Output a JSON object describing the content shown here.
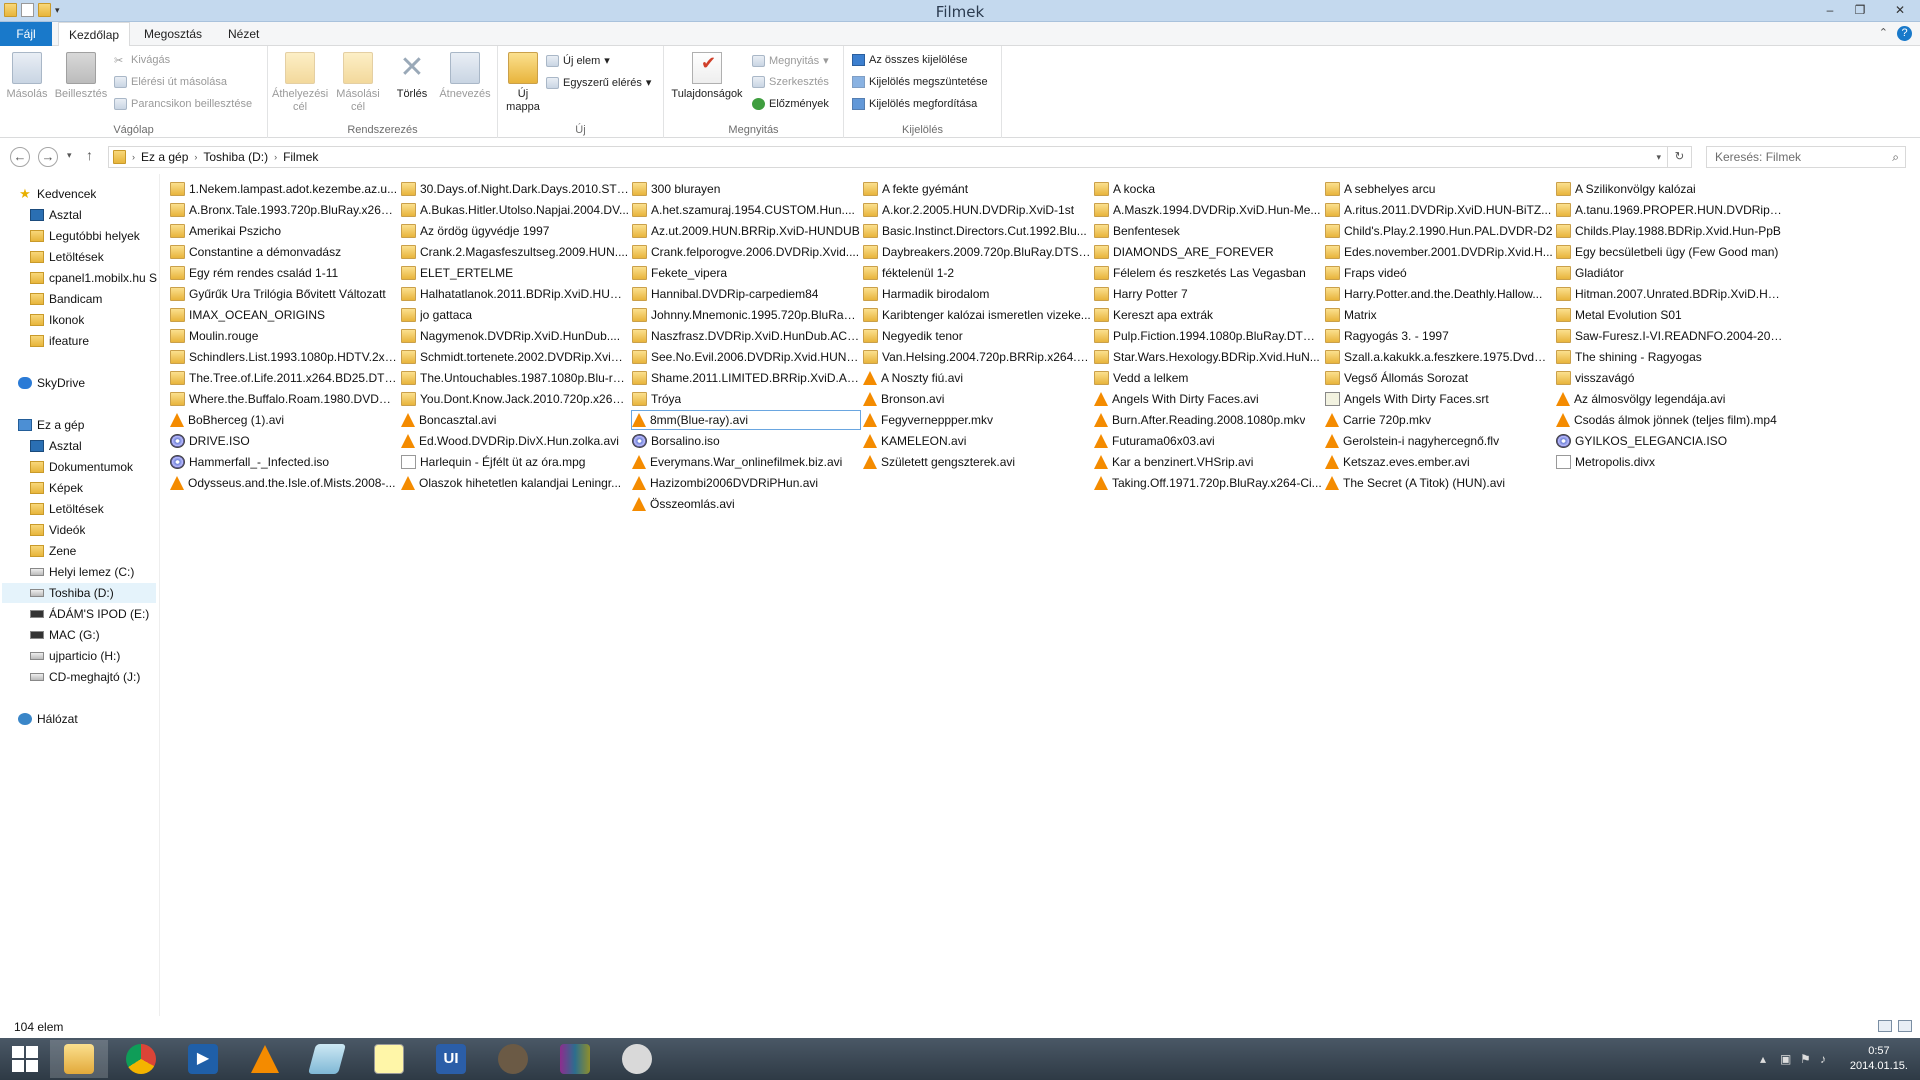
{
  "window": {
    "title": "Filmek",
    "minimize": "–",
    "maximize": "❐",
    "close": "✕"
  },
  "tabs": {
    "file": "Fájl",
    "home": "Kezdőlap",
    "share": "Megosztás",
    "view": "Nézet"
  },
  "ribbon": {
    "clipboard": {
      "label": "Vágólap",
      "copy": "Másolás",
      "paste": "Beillesztés",
      "cut": "Kivágás",
      "copy_path": "Elérési út másolása",
      "paste_shortcut": "Parancsikon beillesztése"
    },
    "organize": {
      "label": "Rendszerezés",
      "move_to": "Áthelyezési cél",
      "copy_to": "Másolási cél",
      "delete": "Törlés",
      "rename": "Átnevezés"
    },
    "new": {
      "label": "Új",
      "new_folder": "Új mappa",
      "new_item": "Új elem",
      "easy_access": "Egyszerű elérés"
    },
    "open": {
      "label": "Megnyitás",
      "properties": "Tulajdonságok",
      "open": "Megnyitás",
      "edit": "Szerkesztés",
      "history": "Előzmények"
    },
    "select": {
      "label": "Kijelölés",
      "select_all": "Az összes kijelölése",
      "select_none": "Kijelölés megszüntetése",
      "invert": "Kijelölés megfordítása"
    }
  },
  "address": {
    "crumbs": [
      "Ez a gép",
      "Toshiba (D:)",
      "Filmek"
    ],
    "search_placeholder": "Keresés: Filmek"
  },
  "nav": {
    "favorites": "Kedvencek",
    "fav_items": [
      "Asztal",
      "Legutóbbi helyek",
      "Letöltések",
      "cpanel1.mobilx.hu S",
      "Bandicam",
      "Ikonok",
      "ifeature"
    ],
    "skydrive": "SkyDrive",
    "this_pc": "Ez a gép",
    "pc_items": [
      "Asztal",
      "Dokumentumok",
      "Képek",
      "Letöltések",
      "Videók",
      "Zene",
      "Helyi lemez (C:)",
      "Toshiba (D:)",
      "ÁDÁM'S IPOD (E:)",
      "MAC (G:)",
      "ujparticio (H:)",
      "CD-meghajtó (J:)"
    ],
    "network": "Hálózat"
  },
  "columns": [
    [
      {
        "n": "1.Nekem.lampast.adot.kezembe.az.u...",
        "t": "folder"
      },
      {
        "n": "A.Bronx.Tale.1993.720p.BluRay.x264....",
        "t": "folder"
      },
      {
        "n": "Amerikai Pszicho",
        "t": "folder"
      },
      {
        "n": "Constantine a démonvadász",
        "t": "folder"
      },
      {
        "n": "Egy rém rendes család 1-11",
        "t": "folder"
      },
      {
        "n": "Gyűrűk Ura Trilógia Bővitett Változatt",
        "t": "folder"
      },
      {
        "n": "IMAX_OCEAN_ORIGINS",
        "t": "folder"
      },
      {
        "n": "Moulin.rouge",
        "t": "folder"
      },
      {
        "n": "Schindlers.List.1993.1080p.HDTV.2xB...",
        "t": "folder"
      },
      {
        "n": "The.Tree.of.Life.2011.x264.BD25.DTS...",
        "t": "folder"
      },
      {
        "n": "Where.the.Buffalo.Roam.1980.DVDRi...",
        "t": "folder"
      },
      {
        "n": "BoBherceg (1).avi",
        "t": "vlc"
      },
      {
        "n": "DRIVE.ISO",
        "t": "iso"
      },
      {
        "n": "Hammerfall_-_Infected.iso",
        "t": "iso"
      },
      {
        "n": "Odysseus.and.the.Isle.of.Mists.2008-...",
        "t": "vlc"
      }
    ],
    [
      {
        "n": "30.Days.of.Night.Dark.Days.2010.STV...",
        "t": "folder"
      },
      {
        "n": "A.Bukas.Hitler.Utolso.Napjai.2004.DV...",
        "t": "folder"
      },
      {
        "n": "Az ördög ügyvédje 1997",
        "t": "folder"
      },
      {
        "n": "Crank.2.Magasfeszultseg.2009.HUN....",
        "t": "folder"
      },
      {
        "n": "ELET_ERTELME",
        "t": "folder"
      },
      {
        "n": "Halhatatlanok.2011.BDRip.XviD.HUN....",
        "t": "folder"
      },
      {
        "n": "jo gattaca",
        "t": "folder"
      },
      {
        "n": "Nagymenok.DVDRip.XviD.HunDub....",
        "t": "folder"
      },
      {
        "n": "Schmidt.tortenete.2002.DVDRip.XviD....",
        "t": "folder"
      },
      {
        "n": "The.Untouchables.1987.1080p.Blu-ra...",
        "t": "folder"
      },
      {
        "n": "You.Dont.Know.Jack.2010.720p.x264....",
        "t": "folder"
      },
      {
        "n": "Boncasztal.avi",
        "t": "vlc"
      },
      {
        "n": "Ed.Wood.DVDRip.DivX.Hun.zolka.avi",
        "t": "vlc"
      },
      {
        "n": "Harlequin - Éjfélt üt az óra.mpg",
        "t": "generic"
      },
      {
        "n": "Olaszok hihetetlen kalandjai Leningr...",
        "t": "vlc"
      }
    ],
    [
      {
        "n": "300 blurayen",
        "t": "folder"
      },
      {
        "n": "A.het.szamuraj.1954.CUSTOM.Hun....",
        "t": "folder"
      },
      {
        "n": "Az.ut.2009.HUN.BRRip.XviD-HUNDUB",
        "t": "folder"
      },
      {
        "n": "Crank.felporogve.2006.DVDRip.Xvid....",
        "t": "folder"
      },
      {
        "n": "Fekete_vipera",
        "t": "folder"
      },
      {
        "n": "Hannibal.DVDRip-carpediem84",
        "t": "folder"
      },
      {
        "n": "Johnny.Mnemonic.1995.720p.BluRay....",
        "t": "folder"
      },
      {
        "n": "Naszfrasz.DVDRip.XviD.HunDub.AC3...",
        "t": "folder"
      },
      {
        "n": "See.No.Evil.2006.DVDRip.Xvid.HUN-...",
        "t": "folder"
      },
      {
        "n": "Shame.2011.LIMITED.BRRip.XviD.Ab...",
        "t": "folder"
      },
      {
        "n": "Tróya",
        "t": "folder"
      },
      {
        "n": "8mm(Blue-ray).avi",
        "t": "vlc"
      },
      {
        "n": "Borsalino.iso",
        "t": "iso"
      },
      {
        "n": "Everymans.War_onlinefilmek.biz.avi",
        "t": "vlc"
      },
      {
        "n": "Hazizombi2006DVDRiPHun.avi",
        "t": "vlc"
      },
      {
        "n": "Összeomlás.avi",
        "t": "vlc"
      }
    ],
    [
      {
        "n": "A fekte gyémánt",
        "t": "folder"
      },
      {
        "n": "A.kor.2.2005.HUN.DVDRip.XviD-1st",
        "t": "folder"
      },
      {
        "n": "Basic.Instinct.Directors.Cut.1992.Blu...",
        "t": "folder"
      },
      {
        "n": "Daybreakers.2009.720p.BluRay.DTS.x...",
        "t": "folder"
      },
      {
        "n": "féktelenül 1-2",
        "t": "folder"
      },
      {
        "n": "Harmadik birodalom",
        "t": "folder"
      },
      {
        "n": "Karibtenger kalózai ismeretlen vizeke...",
        "t": "folder"
      },
      {
        "n": "Negyedik tenor",
        "t": "folder"
      },
      {
        "n": "Van.Helsing.2004.720p.BRRip.x264.A...",
        "t": "folder"
      },
      {
        "n": "A Noszty fiú.avi",
        "t": "vlc"
      },
      {
        "n": "Bronson.avi",
        "t": "vlc"
      },
      {
        "n": "Fegyverneppper.mkv",
        "t": "vlc"
      },
      {
        "n": "KAMELEON.avi",
        "t": "vlc"
      },
      {
        "n": "Született gengszterek.avi",
        "t": "vlc"
      }
    ],
    [
      {
        "n": "A kocka",
        "t": "folder"
      },
      {
        "n": "A.Maszk.1994.DVDRip.XviD.Hun-Me...",
        "t": "folder"
      },
      {
        "n": "Benfentesek",
        "t": "folder"
      },
      {
        "n": "DIAMONDS_ARE_FOREVER",
        "t": "folder"
      },
      {
        "n": "Félelem és reszketés Las Vegasban",
        "t": "folder"
      },
      {
        "n": "Harry Potter 7",
        "t": "folder"
      },
      {
        "n": "Kereszt apa extrák",
        "t": "folder"
      },
      {
        "n": "Pulp.Fiction.1994.1080p.BluRay.DTS....",
        "t": "folder"
      },
      {
        "n": "Star.Wars.Hexology.BDRip.Xvid.HuN...",
        "t": "folder"
      },
      {
        "n": "Vedd a lelkem",
        "t": "folder"
      },
      {
        "n": "Angels With Dirty Faces.avi",
        "t": "vlc"
      },
      {
        "n": "Burn.After.Reading.2008.1080p.mkv",
        "t": "vlc"
      },
      {
        "n": "Futurama06x03.avi",
        "t": "vlc"
      },
      {
        "n": "Kar a benzinert.VHSrip.avi",
        "t": "vlc"
      },
      {
        "n": "Taking.Off.1971.720p.BluRay.x264-Ci...",
        "t": "vlc"
      }
    ],
    [
      {
        "n": "A sebhelyes arcu",
        "t": "folder"
      },
      {
        "n": "A.ritus.2011.DVDRip.XviD.HUN-BiTZ...",
        "t": "folder"
      },
      {
        "n": "Child's.Play.2.1990.Hun.PAL.DVDR-D2",
        "t": "folder"
      },
      {
        "n": "Edes.november.2001.DVDRip.Xvid.H...",
        "t": "folder"
      },
      {
        "n": "Fraps videó",
        "t": "folder"
      },
      {
        "n": "Harry.Potter.and.the.Deathly.Hallow...",
        "t": "folder"
      },
      {
        "n": "Matrix",
        "t": "folder"
      },
      {
        "n": "Ragyogás 3. - 1997",
        "t": "folder"
      },
      {
        "n": "Szall.a.kakukk.a.feszkere.1975.DvdRi...",
        "t": "folder"
      },
      {
        "n": "Vegső Állomás Sorozat",
        "t": "folder"
      },
      {
        "n": "Angels With Dirty Faces.srt",
        "t": "srt"
      },
      {
        "n": "Carrie 720p.mkv",
        "t": "vlc"
      },
      {
        "n": "Gerolstein-i nagyhercegnő.flv",
        "t": "vlc"
      },
      {
        "n": "Ketszaz.eves.ember.avi",
        "t": "vlc"
      },
      {
        "n": "The Secret    (A Titok) (HUN).avi",
        "t": "vlc"
      }
    ],
    [
      {
        "n": "A Szilikonvölgy kalózai",
        "t": "folder"
      },
      {
        "n": "A.tanu.1969.PROPER.HUN.DVDRip.X...",
        "t": "folder"
      },
      {
        "n": "Childs.Play.1988.BDRip.Xvid.Hun-PpB",
        "t": "folder"
      },
      {
        "n": "Egy becsületbeli ügy (Few Good man)",
        "t": "folder"
      },
      {
        "n": "Gladiátor",
        "t": "folder"
      },
      {
        "n": "Hitman.2007.Unrated.BDRip.XviD.Hun...",
        "t": "folder"
      },
      {
        "n": "Metal Evolution S01",
        "t": "folder"
      },
      {
        "n": "Saw-Furesz.I-VI.READNFO.2004-2009...",
        "t": "folder"
      },
      {
        "n": "The shining - Ragyogas",
        "t": "folder"
      },
      {
        "n": "visszavágó",
        "t": "folder"
      },
      {
        "n": "Az álmosvölgy legendája.avi",
        "t": "vlc"
      },
      {
        "n": "Csodás álmok jönnek (teljes film).mp4",
        "t": "vlc"
      },
      {
        "n": "GYILKOS_ELEGANCIA.ISO",
        "t": "iso"
      },
      {
        "n": "Metropolis.divx",
        "t": "generic"
      }
    ]
  ],
  "status": {
    "count": "104 elem"
  },
  "clock": {
    "time": "0:57",
    "date": "2014.01.15."
  }
}
